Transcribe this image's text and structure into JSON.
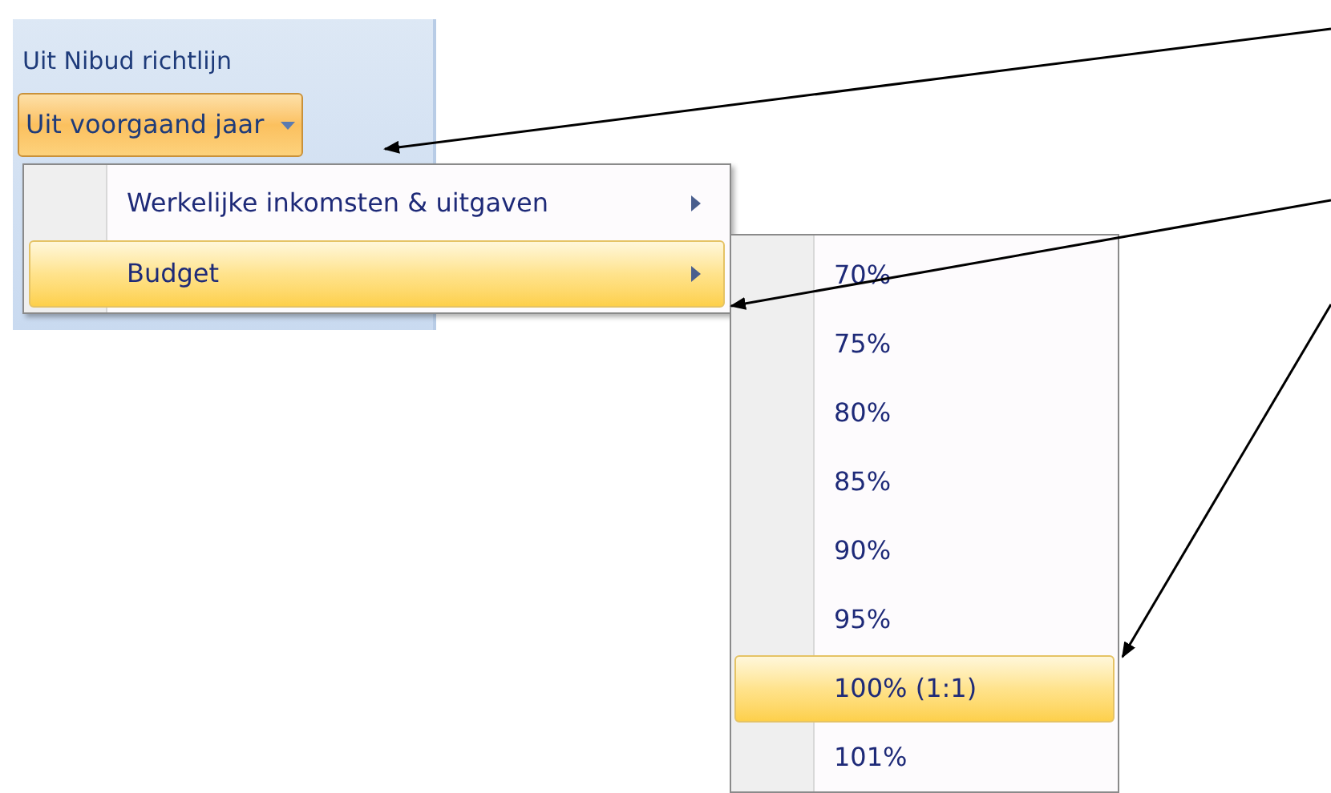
{
  "ribbon": {
    "label": "Uit Nibud richtlijn",
    "dropdown": {
      "label": "Uit voorgaand jaar",
      "open": true
    }
  },
  "menu": {
    "items": [
      {
        "label": "Werkelijke inkomsten & uitgaven",
        "selected": false,
        "submenu": true
      },
      {
        "label": "Budget",
        "selected": true,
        "submenu": true
      }
    ]
  },
  "submenu": {
    "items": [
      {
        "label": "70%",
        "selected": false
      },
      {
        "label": "75%",
        "selected": false
      },
      {
        "label": "80%",
        "selected": false
      },
      {
        "label": "85%",
        "selected": false
      },
      {
        "label": "90%",
        "selected": false
      },
      {
        "label": "95%",
        "selected": false
      },
      {
        "label": "100% (1:1)",
        "selected": true
      },
      {
        "label": "101%",
        "selected": false
      }
    ]
  }
}
